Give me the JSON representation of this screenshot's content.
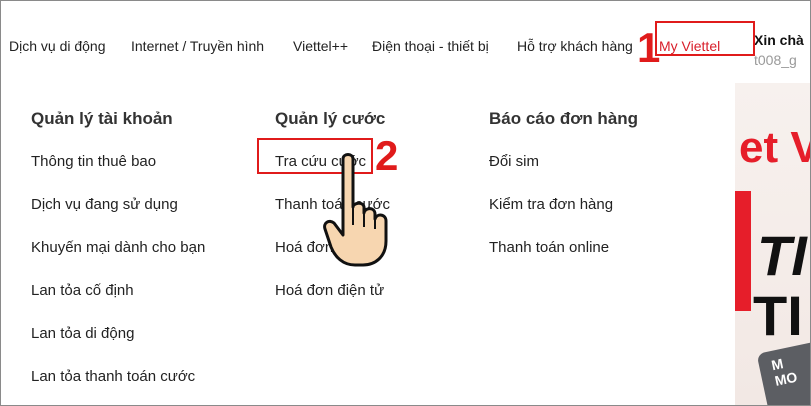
{
  "nav": {
    "items": [
      {
        "label": "Dịch vụ di động"
      },
      {
        "label": "Internet / Truyền hình"
      },
      {
        "label": "Viettel++"
      },
      {
        "label": "Điện thoại - thiết bị"
      },
      {
        "label": "Hỗ trợ khách hàng"
      },
      {
        "label": "My Viettel"
      }
    ],
    "active_color": "#d81e2a"
  },
  "user": {
    "greeting": "Xin chà",
    "account": "t008_g"
  },
  "annotations": {
    "step1": "1",
    "step2": "2",
    "color": "#e01b1b"
  },
  "menu": {
    "columns": [
      {
        "heading": "Quản lý tài khoản",
        "items": [
          "Thông tin thuê bao",
          "Dịch vụ đang sử dụng",
          "Khuyến mại dành cho bạn",
          "Lan tỏa cố định",
          "Lan tỏa di động",
          "Lan tỏa thanh toán cước"
        ]
      },
      {
        "heading": "Quản lý cước",
        "items": [
          "Tra cứu cước",
          "Thanh toán cước",
          "Hoá đơn thông",
          "Hoá đơn điện tử"
        ]
      },
      {
        "heading": "Báo cáo đơn hàng",
        "items": [
          "Đổi sim",
          "Kiểm tra đơn hàng",
          "Thanh toán online"
        ]
      }
    ]
  },
  "banner": {
    "text1": "et V",
    "text2": "TI",
    "text3": "TI",
    "pill_line1": "M",
    "pill_line2": "MO",
    "accent": "#e61e2a"
  }
}
